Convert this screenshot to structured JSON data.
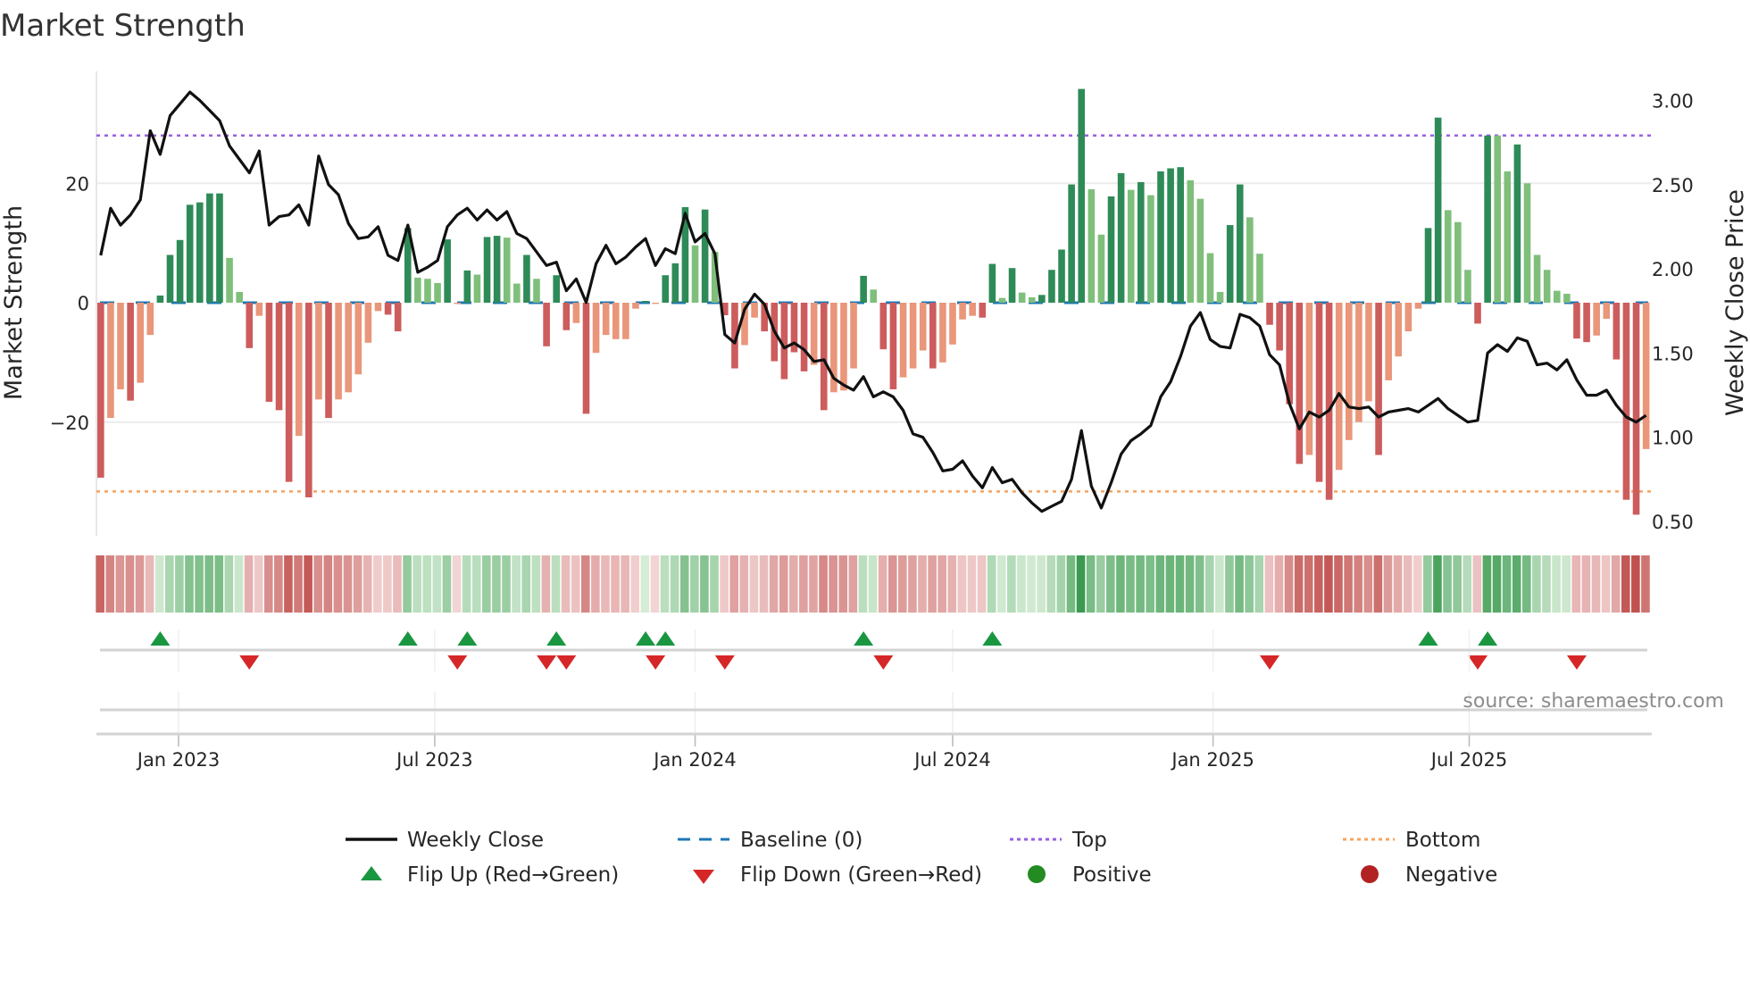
{
  "title": "Market Strength",
  "source": "source: sharemaestro.com",
  "legend": {
    "weekly_close": "Weekly Close",
    "baseline": "Baseline (0)",
    "top": "Top",
    "bottom": "Bottom",
    "flip_up": "Flip Up (Red→Green)",
    "flip_down": "Flip Down (Green→Red)",
    "positive": "Positive",
    "negative": "Negative"
  },
  "colors": {
    "pos_strong": "#2e8b57",
    "pos_weak": "#7fbf7b",
    "neg_strong": "#cd5c5c",
    "neg_weak": "#e9967a",
    "baseline": "#1f77b4",
    "top": "#9a5fe0",
    "bottom": "#f4a460",
    "flip_up": "#1a9641",
    "flip_down": "#d62728",
    "positive": "#228b22",
    "negative": "#b22222",
    "price": "#111111"
  },
  "chart_data": {
    "type": "bar",
    "title": "Market Strength",
    "ylabel": "Market Strength",
    "y2label": "Weekly Close Price",
    "ylim": [
      -38.5,
      39
    ],
    "y2lim": [
      0.42,
      3.2
    ],
    "yticks": [
      "20",
      "0",
      "−20"
    ],
    "ytick_values": [
      20,
      0,
      -20
    ],
    "y2ticks": [
      "3.00",
      "2.50",
      "2.00",
      "1.50",
      "1.00",
      "0.50"
    ],
    "y2tick_values": [
      3.0,
      2.5,
      2.0,
      1.5,
      1.0,
      0.5
    ],
    "xticks": [
      "Jan 2023",
      "Jul 2023",
      "Jan 2024",
      "Jul 2024",
      "Jan 2025",
      "Jul 2025"
    ],
    "xtick_dates": [
      "2023-01-01",
      "2023-07-01",
      "2024-01-01",
      "2024-07-01",
      "2025-01-01",
      "2025-07-01"
    ],
    "x_start": "2022-11-07",
    "x_step_days": 7,
    "top_level": 28,
    "bottom_level": -31.6,
    "baseline": 0,
    "strength": [
      -29.3,
      -19.3,
      -14.5,
      -16.4,
      -13.4,
      -5.4,
      1.2,
      8,
      10.5,
      16.4,
      16.8,
      18.3,
      18.3,
      7.5,
      1.8,
      -7.6,
      -2.2,
      -16.6,
      -18,
      -30,
      -22.3,
      -32.6,
      -16.2,
      -19.3,
      -16.2,
      -15,
      -12,
      -6.7,
      -1.4,
      -2,
      -4.8,
      12.5,
      4.2,
      4,
      3.3,
      10.6,
      -0.2,
      5.4,
      4.7,
      11,
      11.2,
      10.9,
      3.2,
      8,
      4,
      -7.3,
      4.6,
      -4.6,
      -3.4,
      -18.6,
      -8.4,
      -5.4,
      -6.1,
      -6.1,
      -1,
      0.3,
      -0.2,
      4.6,
      6.6,
      16,
      9.6,
      15.6,
      8.5,
      -2.1,
      -11,
      -7.1,
      -2.5,
      -4.8,
      -9.8,
      -12.8,
      -8.3,
      -11.5,
      -10.4,
      -18,
      -15,
      -14.7,
      -11,
      4.5,
      2.2,
      -7.8,
      -14.5,
      -12.5,
      -11,
      -8,
      -11,
      -10,
      -7,
      -2.8,
      -2.2,
      -2.5,
      6.5,
      0.8,
      5.8,
      1.7,
      0.9,
      1.3,
      5.5,
      8.9,
      19.8,
      35.8,
      19,
      11.4,
      17.8,
      21.7,
      18.9,
      20.2,
      18,
      22,
      22.5,
      22.7,
      20.5,
      17.4,
      8.3,
      1.8,
      13,
      19.8,
      14.3,
      8.2,
      -3.7,
      -8,
      -17,
      -27,
      -25.5,
      -30,
      -33,
      -28,
      -23,
      -20,
      -16.5,
      -25.5,
      -13,
      -9,
      -4.8,
      -1,
      12.5,
      31,
      15.5,
      13.5,
      5.5,
      -3.5,
      28,
      28,
      22,
      26.5,
      20,
      8,
      5.5,
      2,
      1.5,
      -6,
      -6.6,
      -5.5,
      -2.7,
      -9.5,
      -33,
      -35.5,
      -24.5
    ],
    "strong": "DLLDLLDDDDDDDLLDLDDDLDLDLLLLLDDDLLLDLDLDDLLDLDDDLDLLLLLDLDDDLDLDDLLDDDDDLDLLLDLDDLLLDLLLLDDLDLLDDDDDLLDDLDLDDDLLLLDDLLDDDDLDDLLLLDLLLLDDLLLDDLLDLLLLLDDLLDDDL",
    "weekly_close": [
      2.08,
      2.36,
      2.26,
      2.32,
      2.41,
      2.82,
      2.68,
      2.91,
      2.98,
      3.05,
      3.0,
      2.94,
      2.88,
      2.73,
      2.65,
      2.57,
      2.7,
      2.26,
      2.31,
      2.32,
      2.38,
      2.26,
      2.67,
      2.5,
      2.44,
      2.27,
      2.18,
      2.19,
      2.25,
      2.08,
      2.05,
      2.26,
      1.98,
      2.01,
      2.05,
      2.25,
      2.32,
      2.36,
      2.29,
      2.35,
      2.29,
      2.34,
      2.21,
      2.18,
      2.1,
      2.02,
      2.04,
      1.87,
      1.94,
      1.8,
      2.03,
      2.14,
      2.03,
      2.07,
      2.13,
      2.18,
      2.02,
      2.12,
      2.09,
      2.33,
      2.16,
      2.21,
      2.09,
      1.61,
      1.56,
      1.76,
      1.85,
      1.79,
      1.63,
      1.53,
      1.56,
      1.52,
      1.45,
      1.46,
      1.35,
      1.31,
      1.28,
      1.36,
      1.24,
      1.27,
      1.24,
      1.16,
      1.02,
      1.0,
      0.91,
      0.8,
      0.81,
      0.86,
      0.77,
      0.7,
      0.82,
      0.73,
      0.75,
      0.67,
      0.61,
      0.56,
      0.59,
      0.62,
      0.75,
      1.04,
      0.71,
      0.58,
      0.73,
      0.9,
      0.98,
      1.02,
      1.07,
      1.24,
      1.33,
      1.48,
      1.66,
      1.74,
      1.58,
      1.54,
      1.53,
      1.73,
      1.71,
      1.66,
      1.49,
      1.43,
      1.2,
      1.05,
      1.15,
      1.12,
      1.16,
      1.26,
      1.18,
      1.17,
      1.18,
      1.12,
      1.15,
      1.16,
      1.17,
      1.15,
      1.19,
      1.23,
      1.17,
      1.13,
      1.09,
      1.1,
      1.5,
      1.55,
      1.51,
      1.59,
      1.57,
      1.43,
      1.44,
      1.4,
      1.46,
      1.34,
      1.25,
      1.25,
      1.28,
      1.19,
      1.12,
      1.09,
      1.13
    ],
    "legend_position": "bottom",
    "grid": true
  }
}
